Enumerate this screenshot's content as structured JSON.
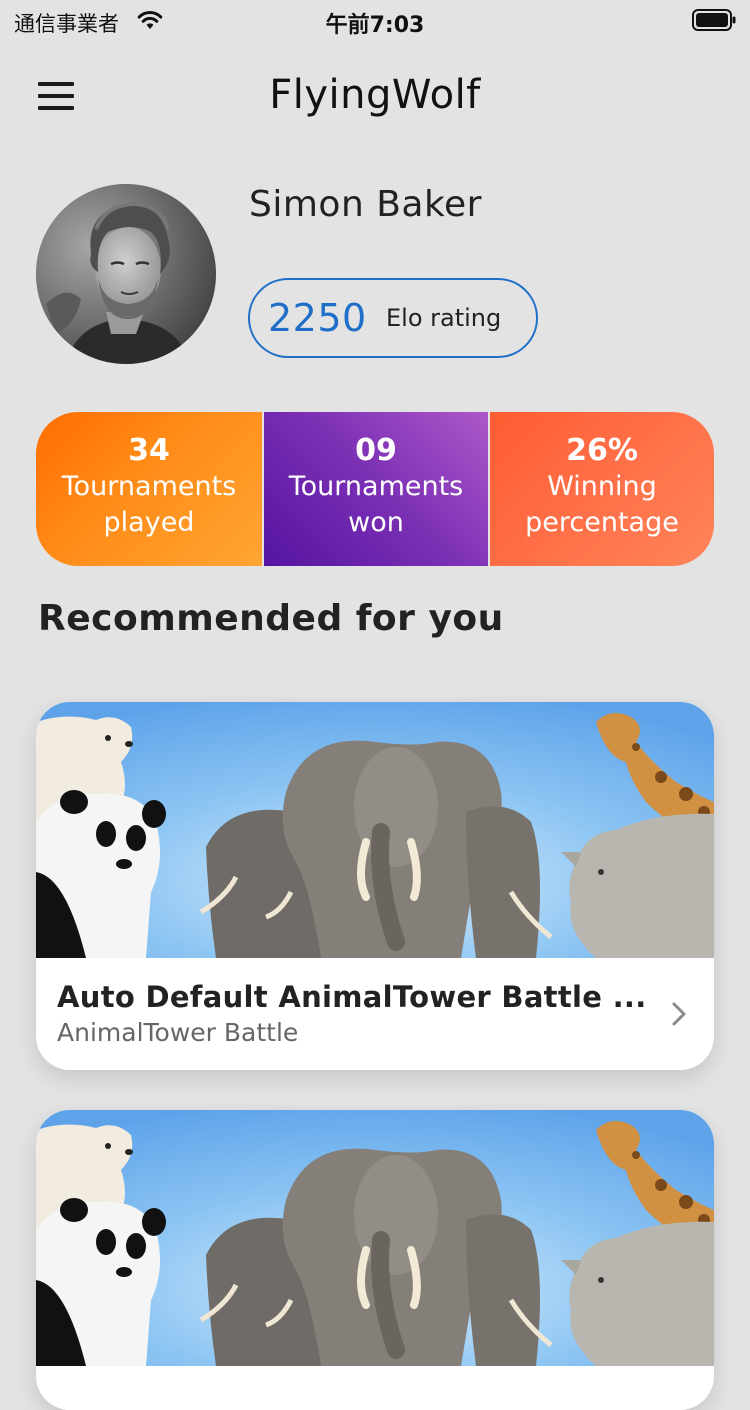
{
  "status_bar": {
    "carrier": "通信事業者",
    "time": "午前7:03",
    "wifi_icon": "wifi-icon",
    "battery_icon": "battery-icon"
  },
  "header": {
    "title": "FlyingWolf",
    "menu_icon": "hamburger-menu-icon"
  },
  "profile": {
    "name": "Simon Baker",
    "elo_value": "2250",
    "elo_label": "Elo rating"
  },
  "stats": [
    {
      "value": "34",
      "label": "Tournaments played",
      "colors": [
        "#ff6c00",
        "#ffa533"
      ]
    },
    {
      "value": "09",
      "label": "Tournaments won",
      "colors": [
        "#5514a1",
        "#ad58c9"
      ]
    },
    {
      "value": "26%",
      "label": "Winning percentage",
      "colors": [
        "#ff5c31",
        "#ff8459"
      ]
    }
  ],
  "recommended": {
    "heading": "Recommended for you",
    "cards": [
      {
        "title": "Auto Default AnimalTower Battle ...",
        "subtitle": "AnimalTower Battle"
      },
      {
        "title": "",
        "subtitle": ""
      }
    ]
  },
  "colors": {
    "background": "#e3e3e3",
    "accent_blue": "#1f6fc9",
    "text_dark": "#222222",
    "text_muted": "#666666"
  }
}
